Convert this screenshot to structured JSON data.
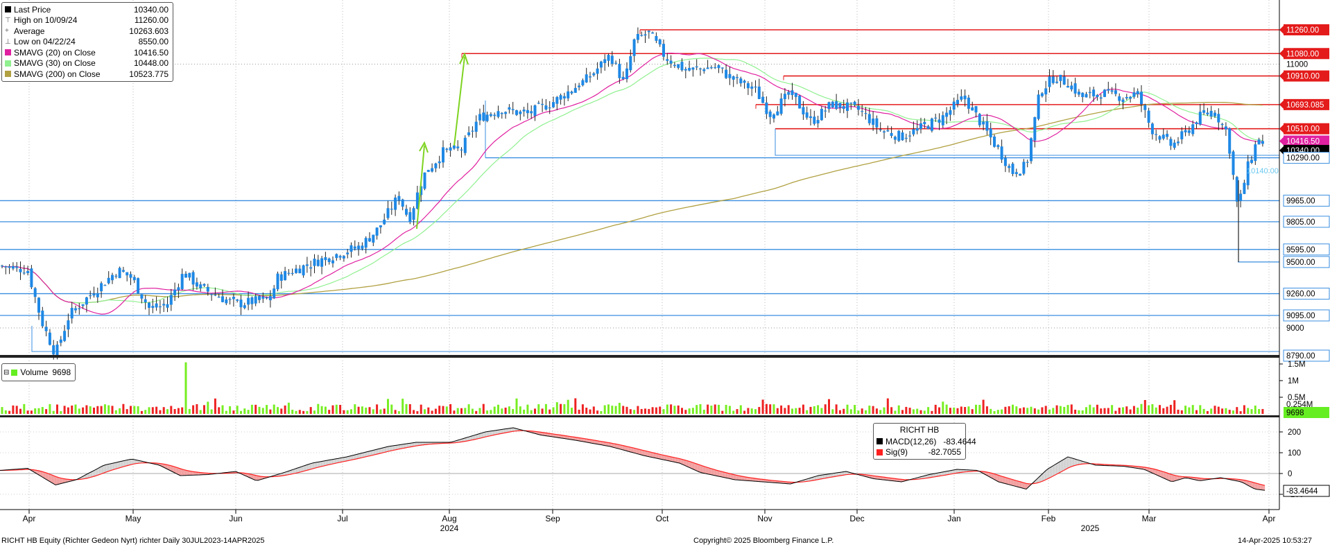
{
  "chart_data": {
    "type": "candlestick",
    "instrument": "RICHT HB",
    "price_levels": {
      "red": [
        11260.0,
        11080.0,
        10910.0,
        10693.085,
        10510.0
      ],
      "blue": [
        10290.0,
        9965.0,
        9805.0,
        9595.0,
        9500.0,
        9260.0,
        9095.0,
        8790.0
      ]
    },
    "price_labels": {
      "red": [
        "11260.00",
        "11080.00",
        "10910.00",
        "10693.085",
        "10510.00"
      ],
      "blue": [
        "10290.00",
        "9965.00",
        "9805.00",
        "9595.00",
        "9500.00",
        "9260.00",
        "9095.00",
        "8790.00"
      ],
      "magenta": "10416.50",
      "last": "10340.00",
      "other": "10290.00",
      "cyan_note": "10140.00"
    },
    "price_axis_ticks": [
      11000,
      9000
    ],
    "price_axis_tick_labels": [
      "11000",
      "9000"
    ],
    "volume_axis_ticks": [
      "1.5M",
      "1M",
      "0.5M"
    ],
    "volume_last_label": "0.254M",
    "volume_badge": "9698",
    "macd_axis_ticks": [
      200,
      100,
      0,
      -100
    ],
    "macd_axis_tick_labels": [
      "200",
      "100",
      "0",
      "-100"
    ],
    "macd_last_label": "-83.4644",
    "months": [
      "Apr",
      "May",
      "Jun",
      "Jul",
      "Aug",
      "Sep",
      "Oct",
      "Nov",
      "Dec",
      "Jan",
      "Feb",
      "Mar",
      "Apr"
    ],
    "years": [
      "2024",
      "2025"
    ],
    "legend_price": [
      {
        "label": "Last Price",
        "value": "10340.00",
        "color": "#000000"
      },
      {
        "label": "High on 10/09/24",
        "value": "11260.00",
        "color": "#666666"
      },
      {
        "label": "Average",
        "value": "10263.603",
        "color": "#666666"
      },
      {
        "label": "Low on 04/22/24",
        "value": "8550.00",
        "color": "#666666"
      },
      {
        "label": "SMAVG (20)  on Close",
        "value": "10416.50",
        "color": "#e020a0"
      },
      {
        "label": "SMAVG (30)  on Close",
        "value": "10448.00",
        "color": "#90f090"
      },
      {
        "label": "SMAVG (200)  on Close",
        "value": "10523.775",
        "color": "#b0a040"
      }
    ],
    "legend_volume": {
      "label": "Volume",
      "value": "9698",
      "color": "#66ee22"
    },
    "legend_macd": {
      "title": "RICHT HB",
      "items": [
        {
          "label": "MACD(12,26)",
          "value": "-83.4644",
          "color": "#000000"
        },
        {
          "label": "Sig(9)",
          "value": "-82.7055",
          "color": "#ff2020"
        }
      ]
    },
    "colors": {
      "up": "#1e88e5",
      "down": "#1e88e5",
      "sma20": "#e020a0",
      "sma30": "#90f090",
      "sma200": "#b0a040",
      "red_level": "#e41b1b",
      "blue_level": "#3a8ee0",
      "vol_up": "#77ee22",
      "vol_down": "#ee2222"
    }
  },
  "footer": {
    "left": "RICHT HB Equity (Richter Gedeon Nyrt) richter  Daily 30JUL2023-14APR2025",
    "center": "Copyright© 2025 Bloomberg Finance L.P.",
    "right": "14-Apr-2025 10:53:27"
  }
}
